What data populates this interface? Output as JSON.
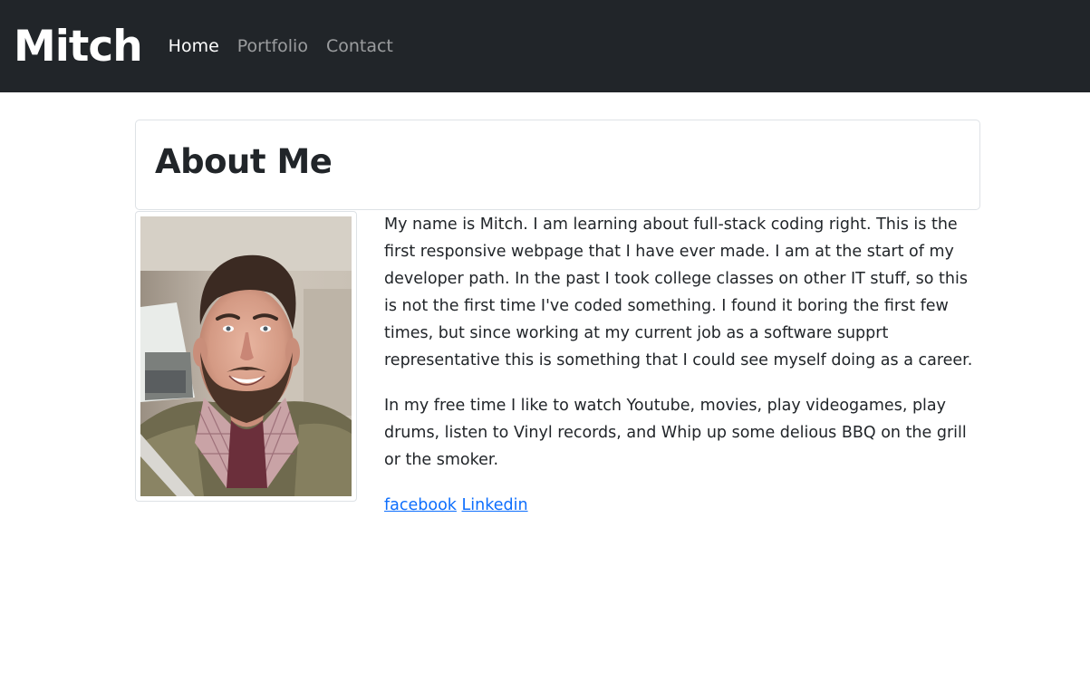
{
  "nav": {
    "brand": "Mitch",
    "links": [
      {
        "label": "Home",
        "active": true
      },
      {
        "label": "Portfolio",
        "active": false
      },
      {
        "label": "Contact",
        "active": false
      }
    ]
  },
  "header": {
    "title": "About Me"
  },
  "photo": {
    "alt": "Photo of Mitch"
  },
  "about": {
    "paragraph1": "My name is Mitch. I am learning about full-stack coding right. This is the first responsive webpage that I have ever made. I am at the start of my developer path. In the past I took college classes on other IT stuff, so this is not the first time I've coded something. I found it boring the first few times, but since working at my current job as a software supprt representative this is something that I could see myself doing as a career.",
    "paragraph2": "In my free time I like to watch Youtube, movies, play videogames, play drums, listen to Vinyl records, and Whip up some delious BBQ on the grill or the smoker."
  },
  "social": {
    "facebook": "facebook",
    "linkedin": "Linkedin"
  },
  "colors": {
    "navbar_bg": "#212529",
    "link": "#0d6efd"
  }
}
